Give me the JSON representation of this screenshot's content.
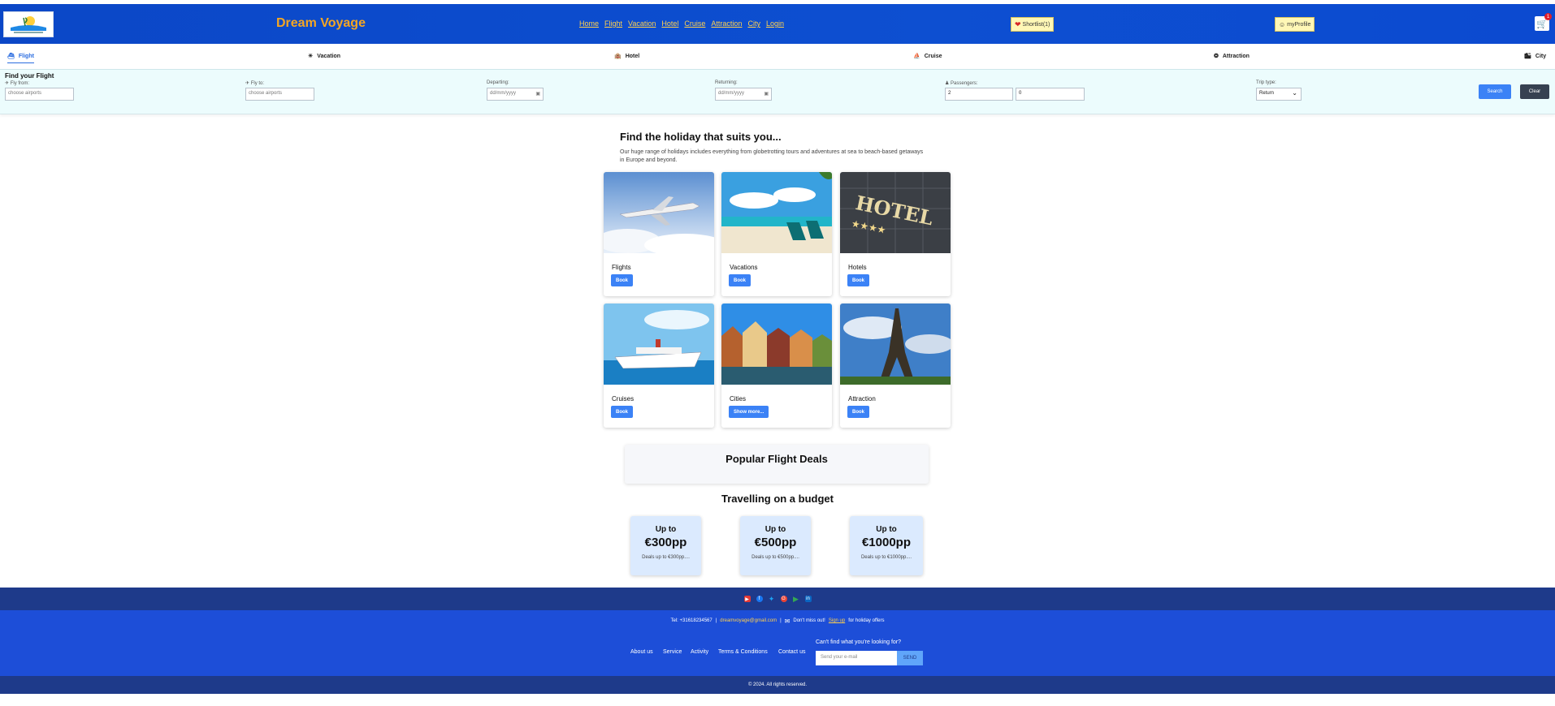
{
  "header": {
    "logo_text": "Dream Voyage",
    "brand": "Dream Voyage",
    "nav": [
      "Home",
      "Flight",
      "Vacation",
      "Hotel",
      "Cruise",
      "Attraction",
      "City",
      "Login"
    ],
    "shortlist": "Shortlist(1)",
    "profile": "myProfile",
    "cart_count": "1"
  },
  "tabs": [
    {
      "label": "Flight",
      "icon": "ship-icon",
      "active": true
    },
    {
      "label": "Vacation",
      "icon": "sun-icon"
    },
    {
      "label": "Hotel",
      "icon": "hotel-icon"
    },
    {
      "label": "Cruise",
      "icon": "cruise-icon"
    },
    {
      "label": "Attraction",
      "icon": "compass-icon"
    },
    {
      "label": "City",
      "icon": "city-icon"
    }
  ],
  "search": {
    "title": "Find your Flight",
    "fly_from_label": "Fly from:",
    "fly_from_placeholder": "choose airports",
    "fly_to_label": "Fly to:",
    "fly_to_placeholder": "choose airports",
    "departing_label": "Departing:",
    "departing_value": "dd/mm/yyyy",
    "returning_label": "Returning:",
    "returning_value": "dd/mm/yyyy",
    "passengers_label": "Passengers:",
    "adults": "2",
    "children": "0",
    "trip_type_label": "Trip type:",
    "trip_type_value": "Return",
    "search_btn": "Search",
    "clear_btn": "Clear"
  },
  "main": {
    "title": "Find the holiday that suits you...",
    "description": "Our huge range of holidays includes everything from globetrotting tours and adventures at sea to beach-based getaways in Europe and beyond."
  },
  "cards": [
    {
      "name": "Flights",
      "button": "Book"
    },
    {
      "name": "Vacations",
      "button": "Book"
    },
    {
      "name": "Hotels",
      "button": "Book"
    },
    {
      "name": "Cruises",
      "button": "Book"
    },
    {
      "name": "Cities",
      "button": "Show more..."
    },
    {
      "name": "Attraction",
      "button": "Book"
    }
  ],
  "popular_deals_title": "Popular Flight Deals",
  "budget": {
    "title": "Travelling on a budget",
    "items": [
      {
        "up": "Up to",
        "amount": "€300pp",
        "text": "Deals up to €300pp"
      },
      {
        "up": "Up to",
        "amount": "€500pp",
        "text": "Deals up to €500pp"
      },
      {
        "up": "Up to",
        "amount": "€1000pp",
        "text": "Deals up to €1000pp"
      }
    ]
  },
  "footer": {
    "social": [
      "youtube-icon",
      "facebook-icon",
      "twitter-icon",
      "google-icon",
      "play-icon",
      "linkedin-icon"
    ],
    "tel": "Tel: +31618234567",
    "email": "dreamvoyage@gmail.com",
    "dont_miss": "Don't miss out!",
    "signup": "Sign up",
    "offers": "for holiday offers",
    "links": [
      "About us",
      "Service",
      "Activity",
      "Terms & Conditions",
      "Contact us"
    ],
    "cant_find": "Can't find what you're looking for?",
    "email_placeholder": "Send your e-mail",
    "send": "SEND",
    "copyright": "© 2024. All rights reserved."
  }
}
